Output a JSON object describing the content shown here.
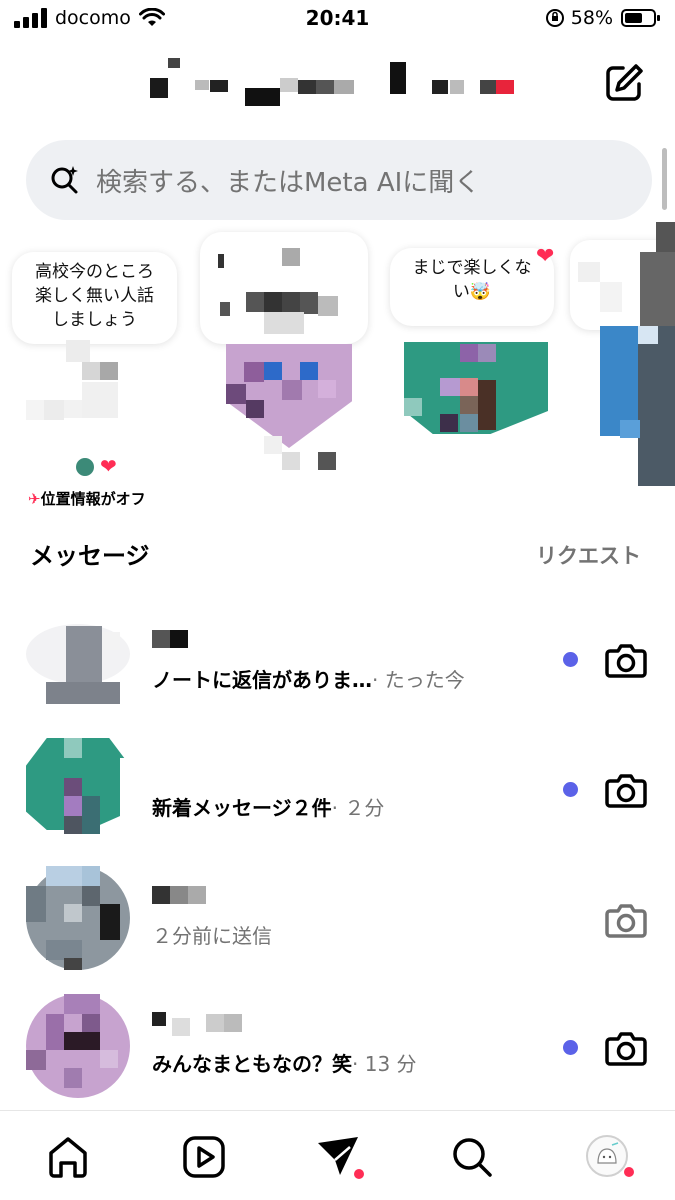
{
  "status_bar": {
    "carrier": "docomo",
    "time": "20:41",
    "battery": "58%"
  },
  "header": {
    "compose_icon": "compose-icon"
  },
  "search": {
    "placeholder": "検索する、またはMeta AIに聞く",
    "icon": "search-ai-icon"
  },
  "notes": [
    {
      "text": "高校今のところ\n楽しく無い人話\nしましょう",
      "caption": "位置情報がオフ"
    },
    {
      "text": ""
    },
    {
      "text": "まじで楽しくな\nい🤯",
      "heart": "❤"
    },
    {
      "text": ""
    }
  ],
  "messages": {
    "title": "メッセージ",
    "requests_label": "リクエスト",
    "threads": [
      {
        "preview": "ノートに返信がありま…",
        "time": "· たった今",
        "unread": true,
        "preview_bold": true
      },
      {
        "preview": "新着メッセージ２件",
        "time": "· ２分",
        "unread": true,
        "preview_bold": true
      },
      {
        "preview": "２分前に送信",
        "time": "",
        "unread": false,
        "preview_bold": false
      },
      {
        "preview": "みんなまともなの？笑",
        "time": "· 13 分",
        "unread": true,
        "preview_bold": true
      }
    ]
  },
  "tab_bar": {
    "tabs": [
      "home-icon",
      "reels-icon",
      "messages-icon",
      "search-icon",
      "profile-avatar"
    ]
  },
  "colors": {
    "unread_dot": "#5b62e8",
    "heart": "#ff2d55",
    "search_bg": "#eef0f3",
    "muted_text": "#737373"
  }
}
